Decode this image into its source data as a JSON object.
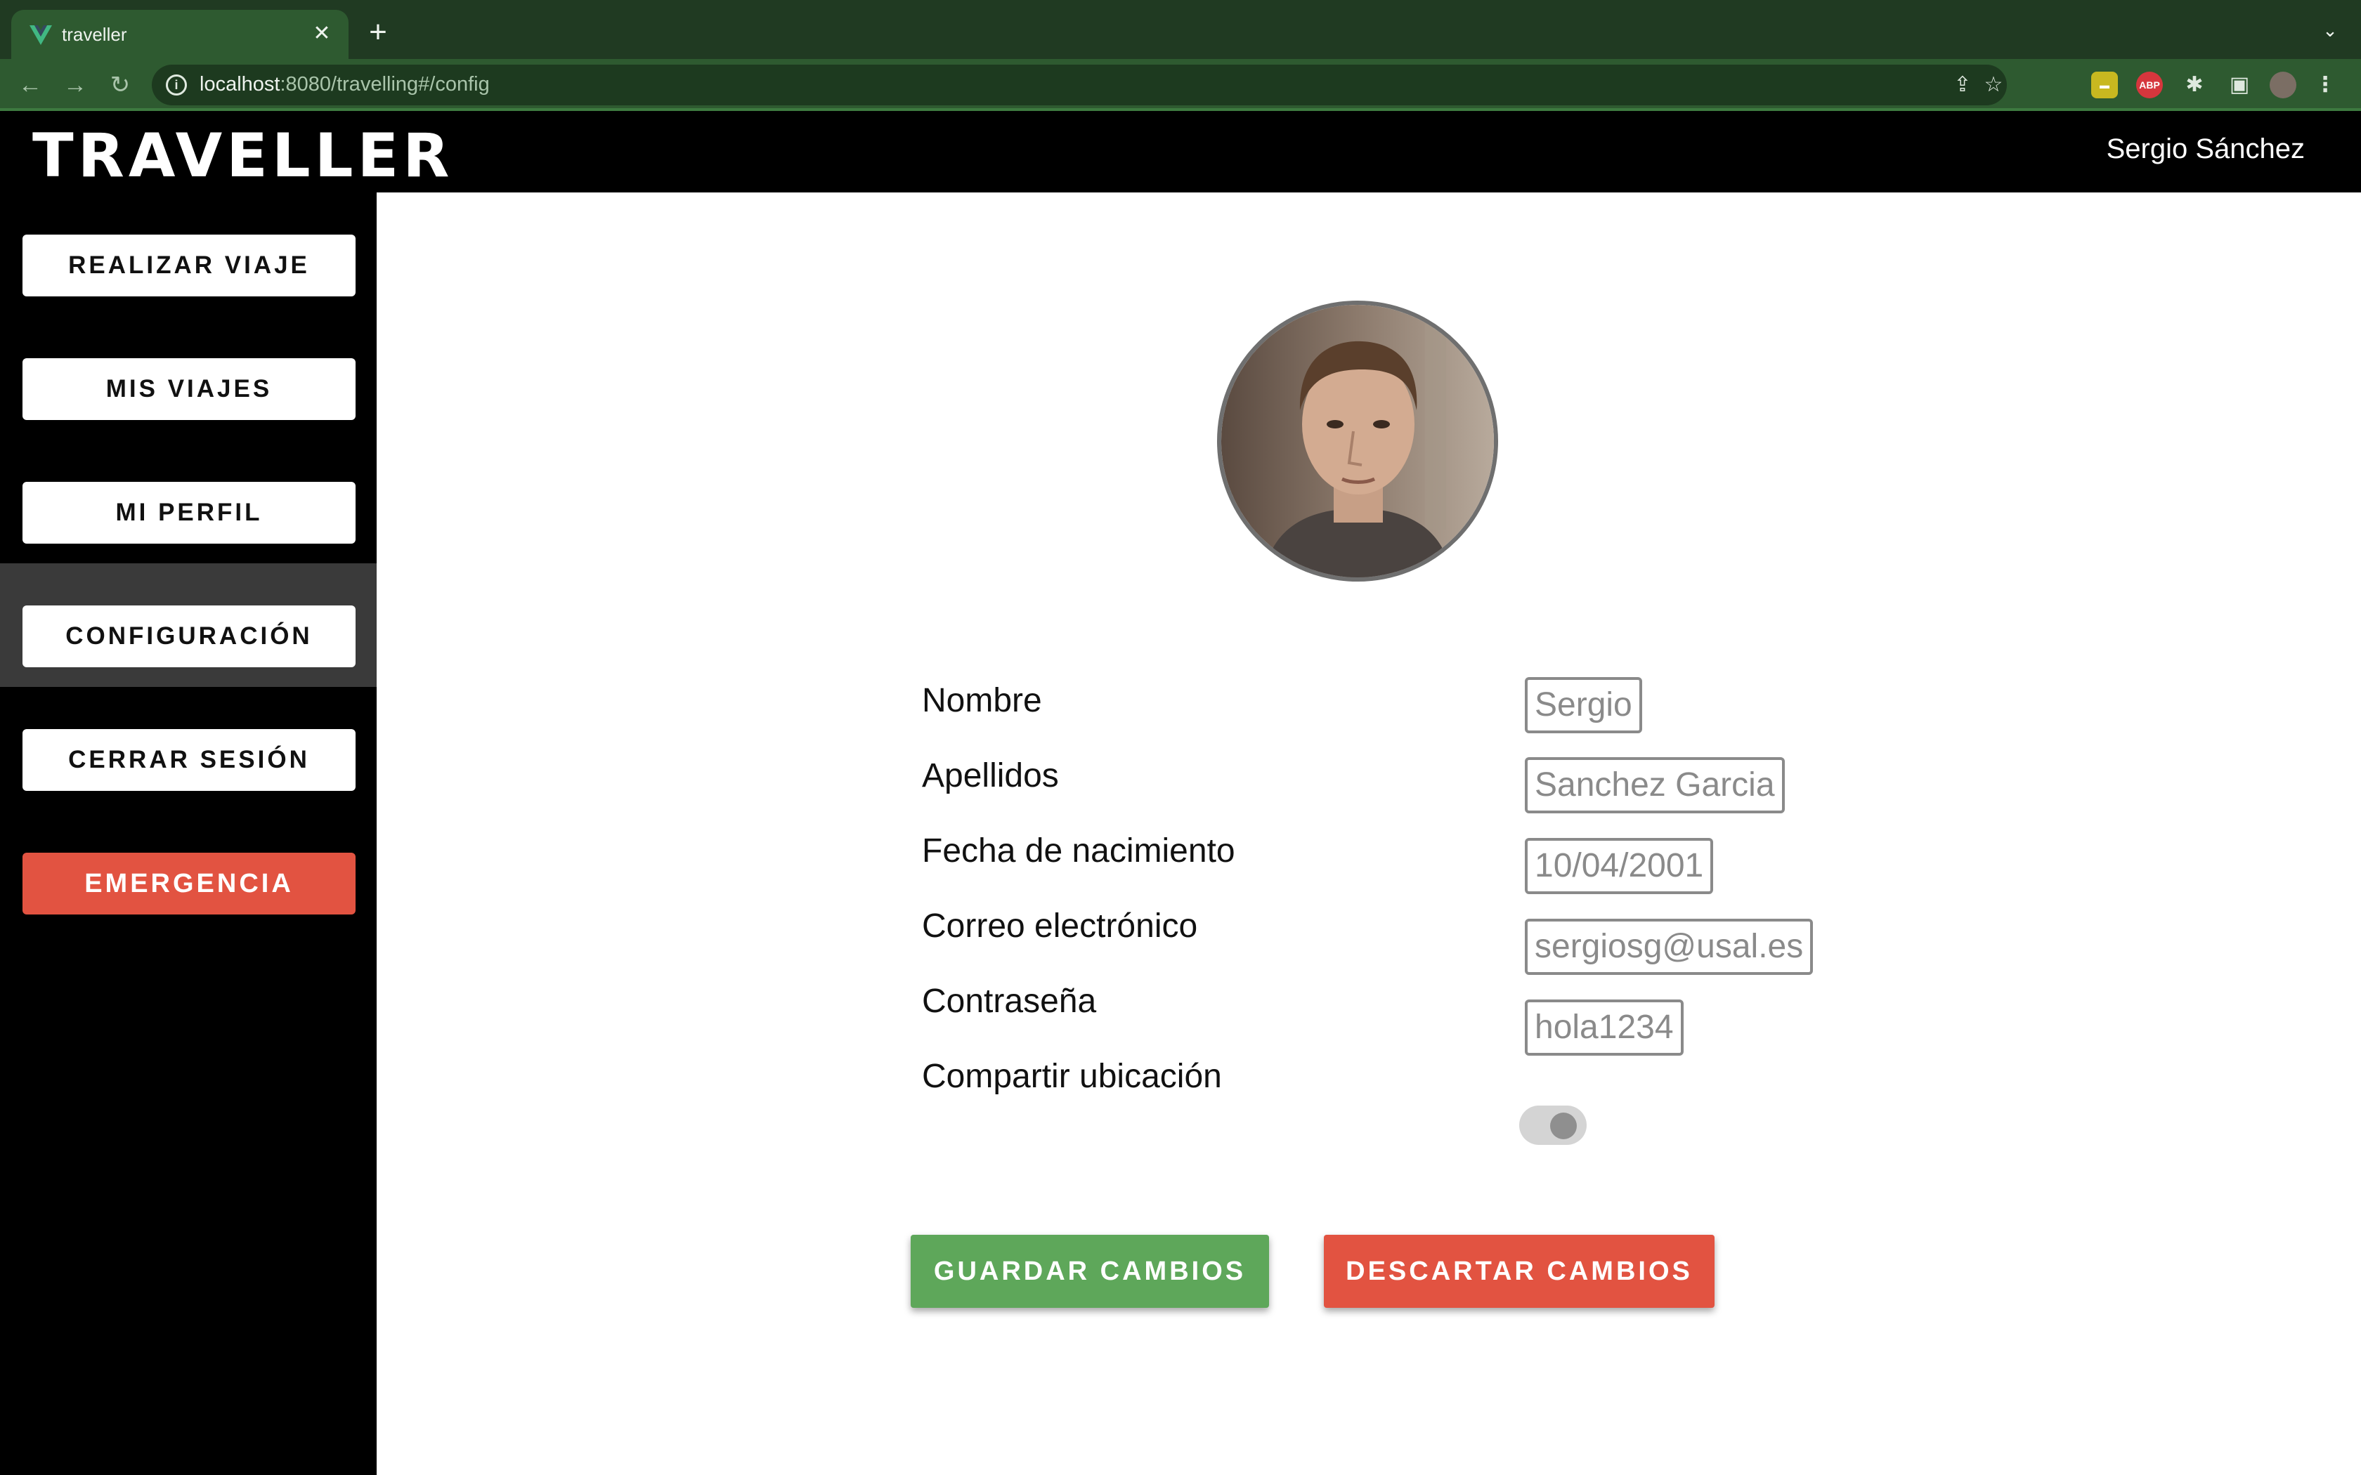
{
  "browser": {
    "tab_title": "traveller",
    "tab_close": "✕",
    "new_tab": "+",
    "url_host": "localhost",
    "url_path": ":8080/travelling#/config"
  },
  "header": {
    "logo": "TRAVELLER",
    "user_name": "Sergio Sánchez"
  },
  "sidebar": {
    "items": [
      {
        "label": "REALIZAR VIAJE"
      },
      {
        "label": "MIS VIAJES"
      },
      {
        "label": "MI PERFIL"
      },
      {
        "label": "CONFIGURACIÓN",
        "active": true
      },
      {
        "label": "CERRAR SESIÓN"
      },
      {
        "label": "EMERGENCIA",
        "variant": "danger"
      }
    ]
  },
  "form": {
    "fields": [
      {
        "label": "Nombre",
        "value": "Sergio"
      },
      {
        "label": "Apellidos",
        "value": "Sanchez Garcia"
      },
      {
        "label": "Fecha de nacimiento",
        "value": "10/04/2001"
      },
      {
        "label": "Correo electrónico",
        "value": "sergiosg@usal.es"
      },
      {
        "label": "Contraseña",
        "value": "hola1234"
      }
    ],
    "share_location": {
      "label": "Compartir ubicación",
      "enabled": false
    }
  },
  "actions": {
    "save_label": "GUARDAR CAMBIOS",
    "discard_label": "DESCARTAR CAMBIOS"
  },
  "colors": {
    "browser_frame": "#203a22",
    "browser_toolbar": "#2e5a30",
    "save": "#5ea75a",
    "danger": "#e25341",
    "active_sidebar": "#3a3a3a"
  }
}
